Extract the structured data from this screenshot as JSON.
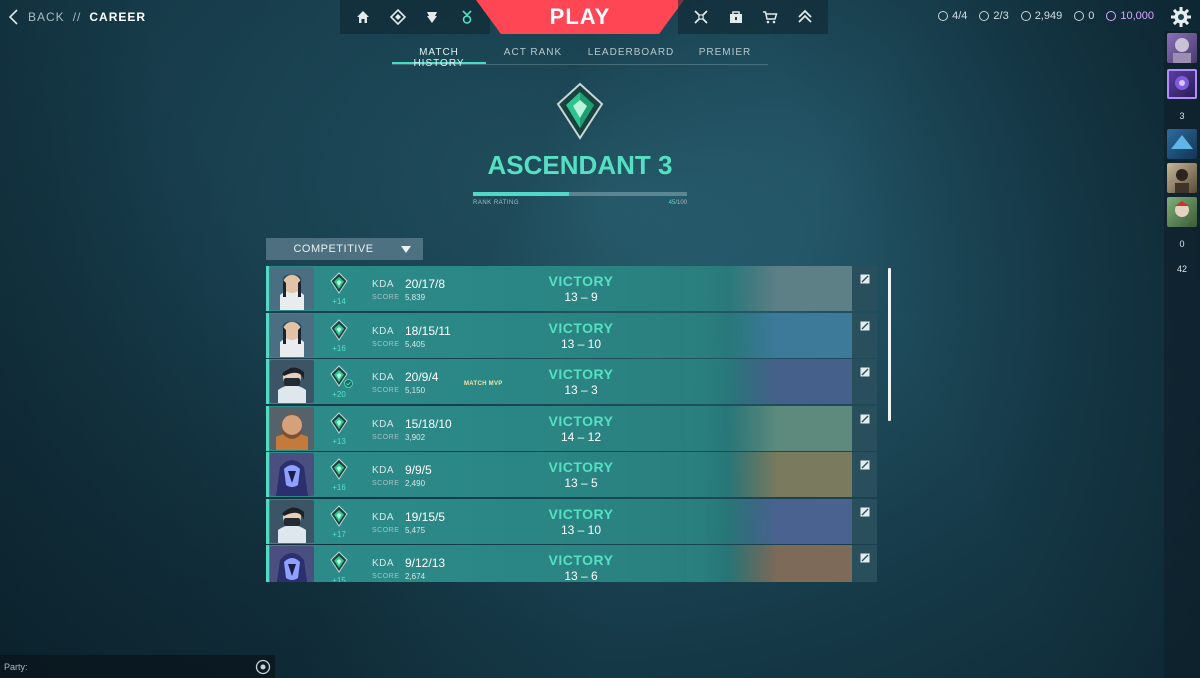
{
  "topbar": {
    "back_label": "BACK",
    "separator": "//",
    "breadcrumb": "CAREER",
    "play_label": "PLAY",
    "nav_left_icons": [
      "home-icon",
      "collection-icon",
      "agents-icon",
      "career-icon"
    ],
    "nav_right_icons": [
      "battlepass-icon",
      "locker-icon",
      "store-icon",
      "rank-icon"
    ],
    "wallet": {
      "missions": "4/4",
      "daily": "2/3",
      "valorant_points": "2,949",
      "radianite": "0",
      "kingdom_credits": "10,000"
    }
  },
  "tabs": [
    {
      "label": "MATCH HISTORY",
      "active": true
    },
    {
      "label": "ACT RANK",
      "active": false
    },
    {
      "label": "LEADERBOARD",
      "active": false
    },
    {
      "label": "PREMIER",
      "active": false
    }
  ],
  "rank": {
    "title": "ASCENDANT 3",
    "rating_label": "RANK RATING",
    "rating_value": "45",
    "rating_max": "/100",
    "rating_fraction": 0.45
  },
  "queue": {
    "selected": "COMPETITIVE"
  },
  "labels": {
    "kda": "KDA",
    "score": "SCORE",
    "mvp": "MATCH MVP"
  },
  "matches": [
    {
      "agent": "sage",
      "rr": "+14",
      "kda": "20/17/8",
      "score": "5,839",
      "result": "VICTORY",
      "rounds": "13 – 9",
      "mvp": false,
      "map_color": "#5d7f86"
    },
    {
      "agent": "sage",
      "rr": "+16",
      "kda": "18/15/11",
      "score": "5,405",
      "result": "VICTORY",
      "rounds": "13 – 10",
      "mvp": false,
      "map_color": "#3d7a9a"
    },
    {
      "agent": "jett",
      "rr": "+20",
      "kda": "20/9/4",
      "score": "5,150",
      "result": "VICTORY",
      "rounds": "13 – 3",
      "mvp": true,
      "map_color": "#45608a"
    },
    {
      "agent": "sova",
      "rr": "+13",
      "kda": "15/18/10",
      "score": "3,902",
      "result": "VICTORY",
      "rounds": "14 – 12",
      "mvp": false,
      "map_color": "#5e8a7d"
    },
    {
      "agent": "omen",
      "rr": "+16",
      "kda": "9/9/5",
      "score": "2,490",
      "result": "VICTORY",
      "rounds": "13 – 5",
      "mvp": false,
      "map_color": "#7a7a5e"
    },
    {
      "agent": "jett",
      "rr": "+17",
      "kda": "19/15/5",
      "score": "5,475",
      "result": "VICTORY",
      "rounds": "13 – 10",
      "mvp": false,
      "map_color": "#4a6290"
    },
    {
      "agent": "omen",
      "rr": "+15",
      "kda": "9/12/13",
      "score": "2,674",
      "result": "VICTORY",
      "rounds": "13 – 6",
      "mvp": false,
      "map_color": "#7d6a58"
    }
  ],
  "social": {
    "count_a": "3",
    "count_b": "0",
    "count_c": "42"
  },
  "party": {
    "label": "Party:"
  },
  "colors": {
    "accent": "#55e0c3",
    "play": "#ff4655",
    "row": "#2a8684"
  }
}
